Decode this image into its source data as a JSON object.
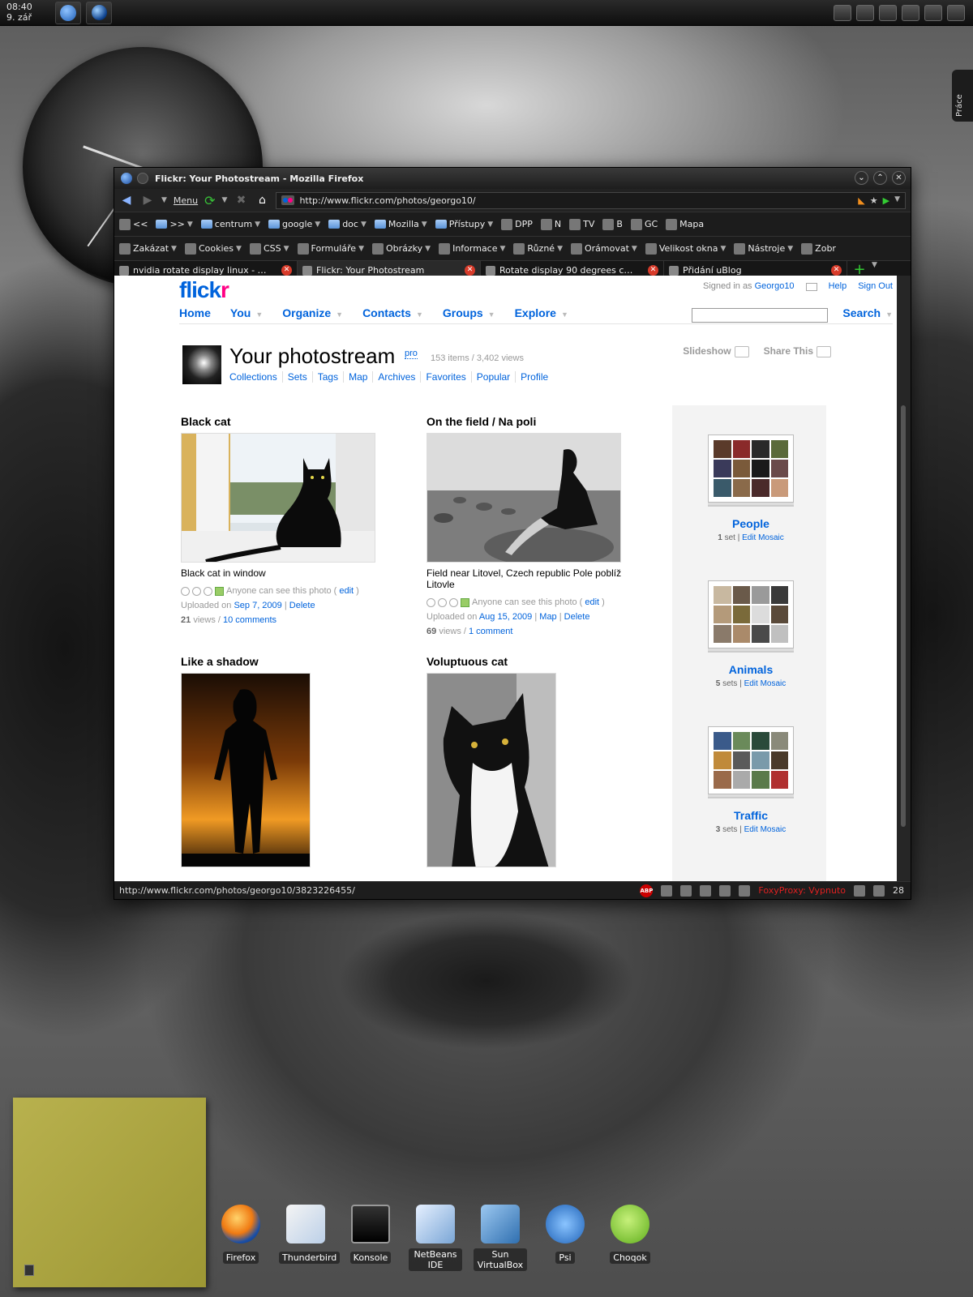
{
  "panel": {
    "time": "08:40",
    "date": "9. zář",
    "vertical_tab": "Práce"
  },
  "window": {
    "title": "Flickr: Your Photostream - Mozilla Firefox",
    "menu_label": "Menu",
    "url": "http://www.flickr.com/photos/georgo10/",
    "status_url": "http://www.flickr.com/photos/georgo10/3823226455/",
    "status_foxy": "FoxyProxy: Vypnuto",
    "status_count": "28"
  },
  "bookmarks": [
    {
      "label": "<<",
      "icon": "bookmark-icon"
    },
    {
      "label": ">>",
      "icon": "folder-icon"
    },
    {
      "label": "centrum",
      "icon": "folder-icon"
    },
    {
      "label": "google",
      "icon": "folder-icon"
    },
    {
      "label": "doc",
      "icon": "folder-icon"
    },
    {
      "label": "Mozilla",
      "icon": "folder-icon"
    },
    {
      "label": "Přístupy",
      "icon": "folder-icon"
    },
    {
      "label": "DPP",
      "icon": "page-icon"
    },
    {
      "label": "N",
      "icon": "page-icon"
    },
    {
      "label": "TV",
      "icon": "page-icon"
    },
    {
      "label": "B",
      "icon": "page-icon"
    },
    {
      "label": "GC",
      "icon": "page-icon"
    },
    {
      "label": "Mapa",
      "icon": "page-icon"
    }
  ],
  "devbar": [
    "Zakázat",
    "Cookies",
    "CSS",
    "Formuláře",
    "Obrázky",
    "Informace",
    "Různé",
    "Orámovat",
    "Velikost okna",
    "Nástroje",
    "Zobr"
  ],
  "tabs": [
    {
      "label": "nvidia rotate display linux - Vyhl...",
      "active": false
    },
    {
      "label": "Flickr: Your Photostream",
      "active": true
    },
    {
      "label": "Rotate display 90 degrees count...",
      "active": false
    },
    {
      "label": "Přidání uBlog",
      "active": false
    }
  ],
  "flickr": {
    "logo_a": "flick",
    "logo_b": "r",
    "signed_in_prefix": "Signed in as",
    "username": "Georgo10",
    "help": "Help",
    "sign_out": "Sign Out",
    "nav": [
      "Home",
      "You",
      "Organize",
      "Contacts",
      "Groups",
      "Explore"
    ],
    "search_label": "Search",
    "title": "Your photostream",
    "pro": "pro",
    "counts": "153 items / 3,402 views",
    "links": [
      "Collections",
      "Sets",
      "Tags",
      "Map",
      "Archives",
      "Favorites",
      "Popular",
      "Profile"
    ],
    "slideshow": "Slideshow",
    "share": "Share This"
  },
  "photos": [
    {
      "title": "Black cat",
      "desc": "Black cat in window",
      "privacy": "Anyone can see this photo",
      "edit": "edit",
      "uploaded_prefix": "Uploaded on",
      "date": "Sep 7, 2009",
      "map": "",
      "delete": "Delete",
      "views": "21",
      "views_suffix": "views /",
      "comments": "10 comments"
    },
    {
      "title": "On the field / Na poli",
      "desc": "Field near Litovel, Czech republic Pole poblíž Litovle",
      "privacy": "Anyone can see this photo",
      "edit": "edit",
      "uploaded_prefix": "Uploaded on",
      "date": "Aug 15, 2009",
      "map": "Map",
      "delete": "Delete",
      "views": "69",
      "views_suffix": "views /",
      "comments": "1 comment"
    },
    {
      "title": "Like a shadow"
    },
    {
      "title": "Voluptuous cat"
    }
  ],
  "sets": [
    {
      "name": "People",
      "count": "1",
      "count_suffix": "set |",
      "edit": "Edit Mosaic"
    },
    {
      "name": "Animals",
      "count": "5",
      "count_suffix": "sets |",
      "edit": "Edit Mosaic"
    },
    {
      "name": "Traffic",
      "count": "3",
      "count_suffix": "sets |",
      "edit": "Edit Mosaic"
    }
  ],
  "dock": [
    {
      "label": "Firefox",
      "icon": "firefox-icon"
    },
    {
      "label": "Thunderbird",
      "icon": "thunderbird-icon"
    },
    {
      "label": "Konsole",
      "icon": "konsole-icon"
    },
    {
      "label": "NetBeans IDE",
      "icon": "netbeans-icon"
    },
    {
      "label": "Sun VirtualBox",
      "icon": "virtualbox-icon"
    },
    {
      "label": "Psi",
      "icon": "psi-icon"
    },
    {
      "label": "Choqok",
      "icon": "choqok-icon"
    }
  ]
}
